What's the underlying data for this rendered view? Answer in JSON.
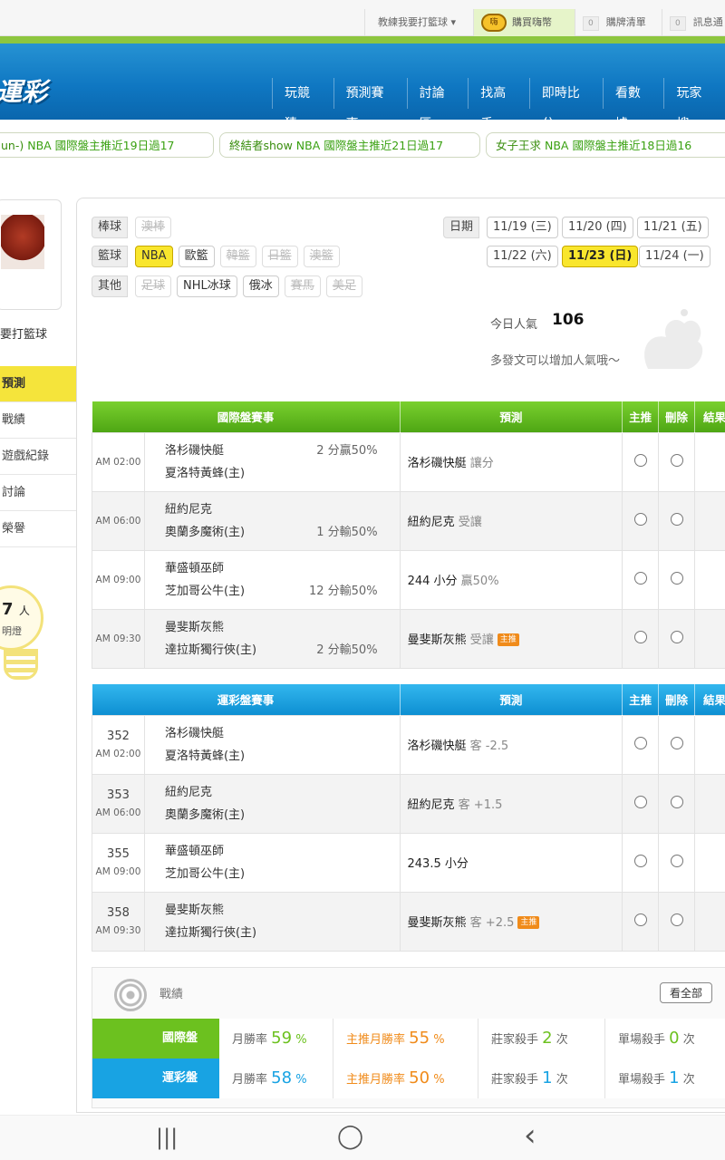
{
  "topbar": {
    "coach": "教練我要打籃球",
    "buy_label": "購買嗨幣",
    "coin_text": "嗨",
    "list_count": "0",
    "list_label": "購牌清單",
    "msg_count": "0",
    "msg_label": "訊息通"
  },
  "header": {
    "logo": "運彩",
    "nav": [
      "玩競猜",
      "預測賽事",
      "討論區",
      "找高手",
      "即時比分",
      "看數據",
      "玩家搜"
    ]
  },
  "ticker": [
    {
      "who": "un-)",
      "text": "NBA 國際盤主推近19日過17"
    },
    {
      "who": "終結者show",
      "text": "NBA 國際盤主推近21日過17"
    },
    {
      "who": "女子王求",
      "text": "NBA 國際盤主推近18日過16"
    }
  ],
  "sidebar": {
    "username": "要打籃球",
    "menu": [
      "預測",
      "戰績",
      "遊戲紀錄",
      "討論",
      "榮譽"
    ],
    "light_count": "7",
    "light_unit": "人",
    "light_label": "明燈"
  },
  "filters": {
    "baseball": {
      "label": "棒球",
      "items": [
        "澳棒"
      ]
    },
    "basketball": {
      "label": "籃球",
      "items": [
        "NBA",
        "歐籃",
        "韓籃",
        "日籃",
        "澳籃"
      ]
    },
    "other": {
      "label": "其他",
      "items": [
        "足球",
        "NHL冰球",
        "俄冰",
        "賽馬",
        "美足"
      ]
    },
    "date_label": "日期",
    "dates": [
      "11/19 (三)",
      "11/20 (四)",
      "11/21 (五)",
      "11/22 (六)",
      "11/23 (日)",
      "11/24 (一)"
    ],
    "selected_date": "11/23 (日)"
  },
  "popularity": {
    "label": "今日人氣",
    "value": "106",
    "note": "多發文可以增加人氣哦～"
  },
  "intl_table": {
    "headers": [
      "國際盤賽事",
      "預測",
      "主推",
      "刪除",
      "結果"
    ],
    "rows": [
      {
        "time": "AM 02:00",
        "team1": "洛杉磯快艇",
        "team2": "夏洛特黃蜂(主)",
        "odds_top": "2 分贏50%",
        "odds_bottom": "",
        "pred": "洛杉磯快艇",
        "pred_note": "讓分",
        "badge": ""
      },
      {
        "time": "AM 06:00",
        "team1": "紐約尼克",
        "team2": "奧蘭多魔術(主)",
        "odds_top": "",
        "odds_bottom": "1 分輸50%",
        "pred": "紐約尼克",
        "pred_note": "受讓",
        "badge": ""
      },
      {
        "time": "AM 09:00",
        "team1": "華盛頓巫師",
        "team2": "芝加哥公牛(主)",
        "odds_top": "",
        "odds_bottom": "12 分輸50%",
        "pred": "244 小分",
        "pred_note": "贏50%",
        "badge": ""
      },
      {
        "time": "AM 09:30",
        "team1": "曼斐斯灰熊",
        "team2": "達拉斯獨行俠(主)",
        "odds_top": "",
        "odds_bottom": "2 分輸50%",
        "pred": "曼斐斯灰熊",
        "pred_note": "受讓",
        "badge": "主推"
      }
    ]
  },
  "sport_table": {
    "headers": [
      "運彩盤賽事",
      "預測",
      "主推",
      "刪除",
      "結果"
    ],
    "rows": [
      {
        "no": "352",
        "time": "AM 02:00",
        "team1": "洛杉磯快艇",
        "team2": "夏洛特黃蜂(主)",
        "pred": "洛杉磯快艇",
        "pred_note": "客 -2.5",
        "badge": ""
      },
      {
        "no": "353",
        "time": "AM 06:00",
        "team1": "紐約尼克",
        "team2": "奧蘭多魔術(主)",
        "pred": "紐約尼克",
        "pred_note": "客 +1.5",
        "badge": ""
      },
      {
        "no": "355",
        "time": "AM 09:00",
        "team1": "華盛頓巫師",
        "team2": "芝加哥公牛(主)",
        "pred": "243.5 小分",
        "pred_note": "",
        "badge": ""
      },
      {
        "no": "358",
        "time": "AM 09:30",
        "team1": "曼斐斯灰熊",
        "team2": "達拉斯獨行俠(主)",
        "pred": "曼斐斯灰熊",
        "pred_note": "客 +2.5",
        "badge": "主推"
      }
    ]
  },
  "stats": {
    "title": "戰績",
    "view_all": "看全部",
    "rows": [
      {
        "label": "國際盤",
        "win_label": "月勝率",
        "win": "59",
        "main_label": "主推月勝率",
        "main": "55",
        "pct": "%",
        "killer_label": "莊家殺手",
        "killer": "2",
        "single_label": "單場殺手",
        "single": "0",
        "times": "次"
      },
      {
        "label": "運彩盤",
        "win_label": "月勝率",
        "win": "58",
        "main_label": "主推月勝率",
        "main": "50",
        "pct": "%",
        "killer_label": "莊家殺手",
        "killer": "1",
        "single_label": "單場殺手",
        "single": "1",
        "times": "次"
      }
    ]
  },
  "navbar": {
    "recent": "|||",
    "home": "◯",
    "back": "‹"
  }
}
